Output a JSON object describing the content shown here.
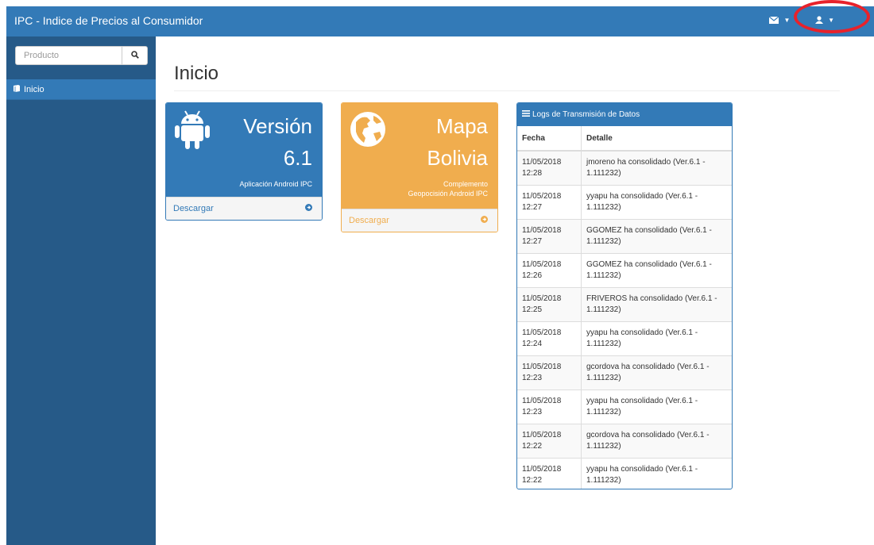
{
  "header": {
    "title": "IPC - Indice de Precios al Consumidor"
  },
  "sidebar": {
    "search": {
      "placeholder": "Producto"
    },
    "items": [
      {
        "label": "Inicio",
        "icon": "book-icon"
      }
    ]
  },
  "main": {
    "title": "Inicio",
    "cards": [
      {
        "icon": "android-icon",
        "title_line1": "Versión",
        "title_line2": "6.1",
        "subtitle": "Aplicación Android IPC",
        "footer": "Descargar",
        "color": "#337ab7"
      },
      {
        "icon": "globe-icon",
        "title_line1": "Mapa",
        "title_line2": "Bolivia",
        "subtitle_line1": "Complemento",
        "subtitle_line2": "Geopocisión Android IPC",
        "footer": "Descargar",
        "color": "#f0ad4e"
      }
    ],
    "logs": {
      "title": "Logs de Transmisión de Datos",
      "columns": [
        "Fecha",
        "Detalle"
      ],
      "rows": [
        {
          "date": "11/05/2018",
          "time": "12:28",
          "d1": "jmoreno ha consolidado (Ver.6.1 -",
          "d2": "1.111232)"
        },
        {
          "date": "11/05/2018",
          "time": "12:27",
          "d1": "yyapu ha consolidado (Ver.6.1 -",
          "d2": "1.111232)"
        },
        {
          "date": "11/05/2018",
          "time": "12:27",
          "d1": "GGOMEZ ha consolidado (Ver.6.1 -",
          "d2": "1.111232)"
        },
        {
          "date": "11/05/2018",
          "time": "12:26",
          "d1": "GGOMEZ ha consolidado (Ver.6.1 -",
          "d2": "1.111232)"
        },
        {
          "date": "11/05/2018",
          "time": "12:25",
          "d1": "FRIVEROS ha consolidado (Ver.6.1 -",
          "d2": "1.111232)"
        },
        {
          "date": "11/05/2018",
          "time": "12:24",
          "d1": "yyapu ha consolidado (Ver.6.1 -",
          "d2": "1.111232)"
        },
        {
          "date": "11/05/2018",
          "time": "12:23",
          "d1": "gcordova ha consolidado (Ver.6.1 -",
          "d2": "1.111232)"
        },
        {
          "date": "11/05/2018",
          "time": "12:23",
          "d1": "yyapu ha consolidado (Ver.6.1 -",
          "d2": "1.111232)"
        },
        {
          "date": "11/05/2018",
          "time": "12:22",
          "d1": "gcordova ha consolidado (Ver.6.1 -",
          "d2": "1.111232)"
        },
        {
          "date": "11/05/2018",
          "time": "12:22",
          "d1": "yyapu ha consolidado (Ver.6.1 -",
          "d2": "1.111232)"
        }
      ]
    }
  },
  "annotation": {
    "color": "#e8222b"
  }
}
